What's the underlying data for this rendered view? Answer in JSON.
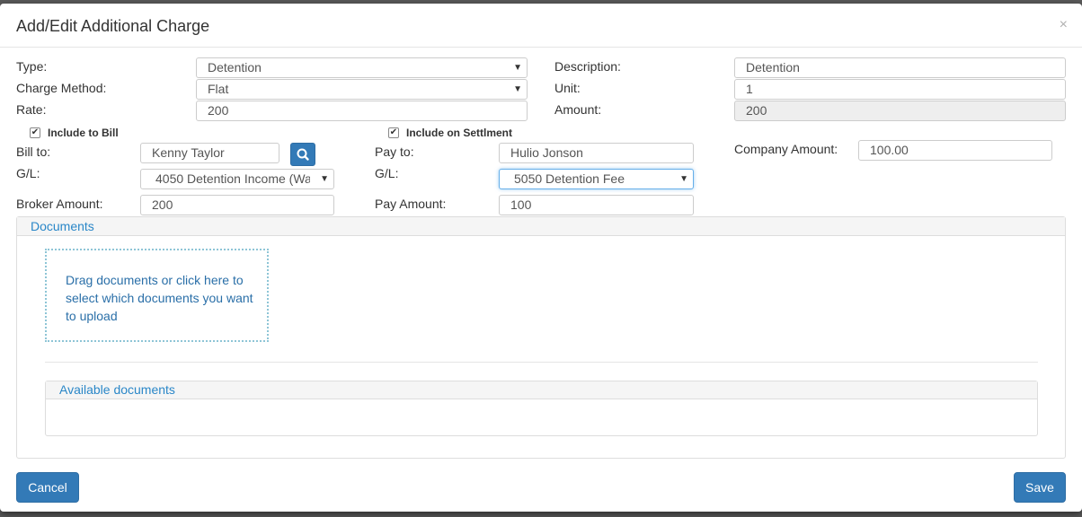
{
  "modal": {
    "title": "Add/Edit Additional Charge",
    "close_label": "×"
  },
  "form": {
    "type": {
      "label": "Type:",
      "value": "Detention"
    },
    "description": {
      "label": "Description:",
      "value": "Detention"
    },
    "charge_method": {
      "label": "Charge Method:",
      "value": "Flat"
    },
    "unit": {
      "label": "Unit:",
      "value": "1"
    },
    "rate": {
      "label": "Rate:",
      "value": "200"
    },
    "amount": {
      "label": "Amount:",
      "value": "200"
    }
  },
  "bill": {
    "include_label": "Include to Bill",
    "include_checked": true,
    "bill_to_label": "Bill to:",
    "bill_to_value": "Kenny Taylor",
    "gl_label": "G/L:",
    "gl_value": "4050 Detention Income (Wa",
    "broker_amount_label": "Broker Amount:",
    "broker_amount_value": "200"
  },
  "settlement": {
    "include_label": "Include on Settlment",
    "include_checked": true,
    "pay_to_label": "Pay to:",
    "pay_to_value": "Hulio Jonson",
    "gl_label": "G/L:",
    "gl_value": "5050 Detention Fee",
    "pay_amount_label": "Pay Amount:",
    "pay_amount_value": "100"
  },
  "company": {
    "amount_label": "Company Amount:",
    "amount_value": "100.00"
  },
  "documents": {
    "title": "Documents",
    "dropzone_text": "Drag documents or click here to select which documents you want to upload",
    "available_title": "Available documents"
  },
  "footer": {
    "cancel_label": "Cancel",
    "save_label": "Save"
  },
  "colors": {
    "primary": "#337ab7",
    "link": "#2a87c8"
  },
  "icons": {
    "search": "search-icon",
    "caret": "chevron-down-icon",
    "check": "checkmark-icon"
  }
}
